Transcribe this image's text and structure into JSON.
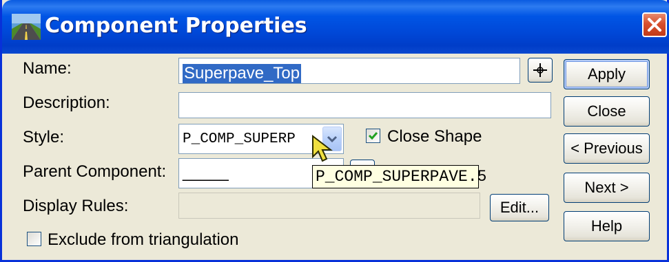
{
  "window": {
    "title": "Component Properties",
    "icon": "road-icon",
    "close_icon": "close-icon"
  },
  "form": {
    "name_label": "Name:",
    "name_value": "Superpave_Top",
    "description_label": "Description:",
    "description_value": "",
    "style_label": "Style:",
    "style_value": "P_COMP_SUPERP",
    "close_shape_label": "Close Shape",
    "close_shape_checked": true,
    "parent_label": "Parent Component:",
    "parent_value": "_____",
    "display_rules_label": "Display Rules:",
    "display_rules_value": "",
    "exclude_label": "Exclude from triangulation",
    "exclude_checked": false
  },
  "buttons": {
    "apply": "Apply",
    "close": "Close",
    "previous": "< Previous",
    "next": "Next >",
    "help": "Help",
    "edit": "Edit..."
  },
  "tooltip": {
    "text": "P_COMP_SUPERPAVE.5"
  },
  "colors": {
    "titlebar": "#0055E5",
    "dialog_bg": "#ECE9D8",
    "selection": "#316AC5",
    "tooltip_bg": "#FFFFE1",
    "close_button": "#D7502E"
  }
}
